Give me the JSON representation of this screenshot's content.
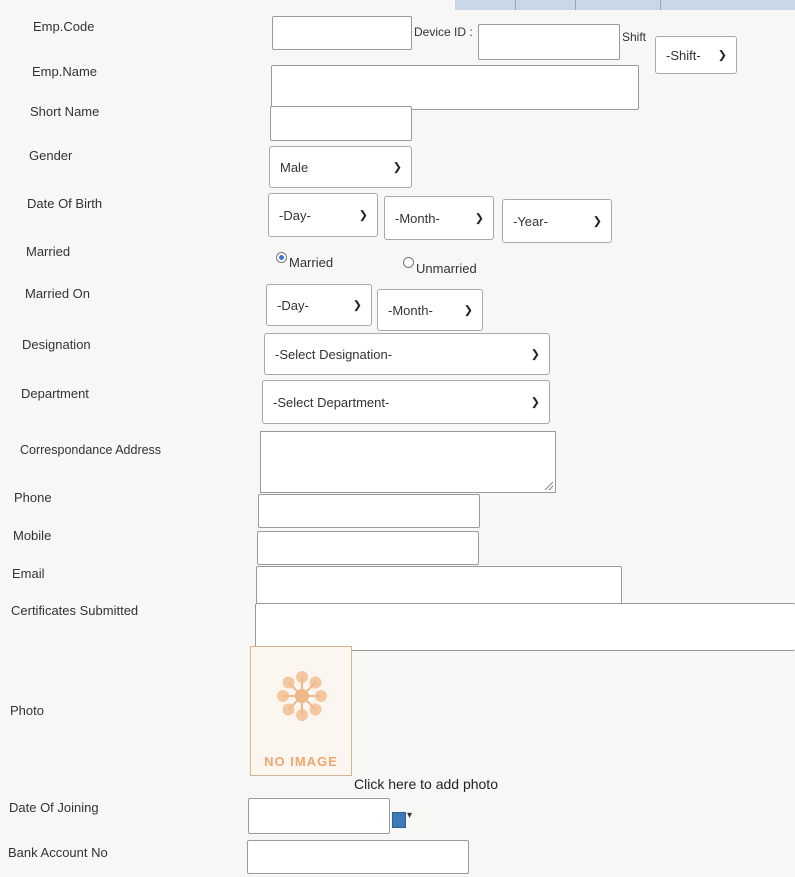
{
  "labels": {
    "emp_code": "Emp.Code",
    "device_id": "Device ID :",
    "shift": "Shift",
    "emp_name": "Emp.Name",
    "short_name": "Short Name",
    "gender": "Gender",
    "dob": "Date Of Birth",
    "married": "Married",
    "married_on": "Married On",
    "designation": "Designation",
    "department": "Department",
    "corr_address": "Correspondance Address",
    "phone": "Phone",
    "mobile": "Mobile",
    "email": "Email",
    "certificates": "Certificates Submitted",
    "photo": "Photo",
    "doj": "Date Of Joining",
    "bank_acc": "Bank Account No"
  },
  "selects": {
    "shift": "-Shift-",
    "gender": "Male",
    "dob_day": "-Day-",
    "dob_month": "-Month-",
    "dob_year": "-Year-",
    "married_day": "-Day-",
    "married_month": "-Month-",
    "designation": "-Select Designation-",
    "department": "-Select Department-"
  },
  "radios": {
    "married": "Married",
    "unmarried": "Unmarried",
    "selected": "married"
  },
  "photo": {
    "placeholder": "NO IMAGE",
    "add_link": "Click here to add photo"
  },
  "icons": {
    "chevron": "chevron-down-icon",
    "calendar": "calendar-icon",
    "photo_placeholder": "flower-icon"
  },
  "colors": {
    "radio_accent": "#3a78c8",
    "noimage_orange": "#f0a770",
    "calendar_blue": "#3f78b8"
  }
}
